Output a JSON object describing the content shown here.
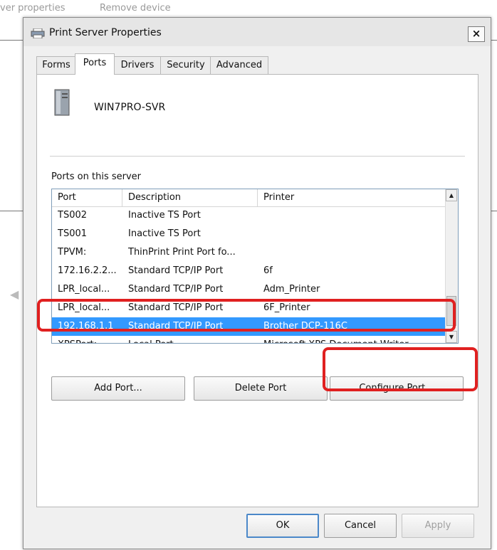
{
  "background": {
    "menu_items": [
      "ver properties",
      "Remove device"
    ]
  },
  "dialog": {
    "title": "Print Server Properties",
    "close_label": "×",
    "tabs": [
      {
        "label": "Forms",
        "active": false
      },
      {
        "label": "Ports",
        "active": true
      },
      {
        "label": "Drivers",
        "active": false
      },
      {
        "label": "Security",
        "active": false
      },
      {
        "label": "Advanced",
        "active": false
      }
    ],
    "server_name": "WIN7PRO-SVR",
    "ports_label": "Ports on this server",
    "list": {
      "columns": [
        "Port",
        "Description",
        "Printer"
      ],
      "rows": [
        {
          "port": "TS002",
          "description": "Inactive TS Port",
          "printer": "",
          "selected": false
        },
        {
          "port": "TS001",
          "description": "Inactive TS Port",
          "printer": "",
          "selected": false
        },
        {
          "port": "TPVM:",
          "description": "ThinPrint Print Port fo...",
          "printer": "",
          "selected": false
        },
        {
          "port": "172.16.2.2...",
          "description": "Standard TCP/IP Port",
          "printer": "6f",
          "selected": false
        },
        {
          "port": "LPR_local...",
          "description": "Standard TCP/IP Port",
          "printer": "Adm_Printer",
          "selected": false
        },
        {
          "port": "LPR_local...",
          "description": "Standard TCP/IP Port",
          "printer": "6F_Printer",
          "selected": false
        },
        {
          "port": "192.168.1.1",
          "description": "Standard TCP/IP Port",
          "printer": "Brother DCP-116C",
          "selected": true
        },
        {
          "port": "XPSPort:",
          "description": "Local Port",
          "printer": "Microsoft XPS Document Writer",
          "selected": false
        }
      ]
    },
    "buttons": {
      "add_port": "Add Port...",
      "delete_port": "Delete Port",
      "configure_port": "Configure Port...",
      "ok": "OK",
      "cancel": "Cancel",
      "apply": "Apply"
    }
  },
  "colors": {
    "selection": "#3399ff",
    "highlight": "#e02020"
  },
  "icons": {
    "title": "printer-icon",
    "server": "server-tower-icon",
    "scroll_up": "scroll-up-arrow-icon",
    "scroll_down": "scroll-down-arrow-icon"
  }
}
